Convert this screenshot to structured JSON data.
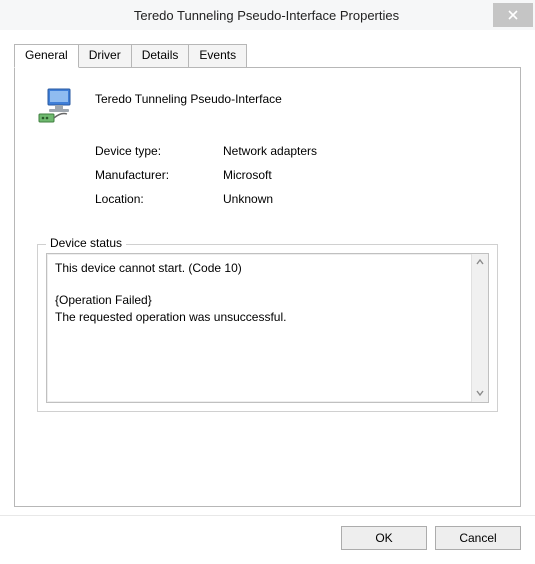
{
  "title": "Teredo Tunneling Pseudo-Interface Properties",
  "tabs": [
    "General",
    "Driver",
    "Details",
    "Events"
  ],
  "device": {
    "name": "Teredo Tunneling Pseudo-Interface",
    "type_label": "Device type:",
    "type_value": "Network adapters",
    "mfr_label": "Manufacturer:",
    "mfr_value": "Microsoft",
    "loc_label": "Location:",
    "loc_value": "Unknown"
  },
  "status": {
    "legend": "Device status",
    "text": "This device cannot start. (Code 10)\n\n{Operation Failed}\nThe requested operation was unsuccessful."
  },
  "buttons": {
    "ok": "OK",
    "cancel": "Cancel"
  }
}
